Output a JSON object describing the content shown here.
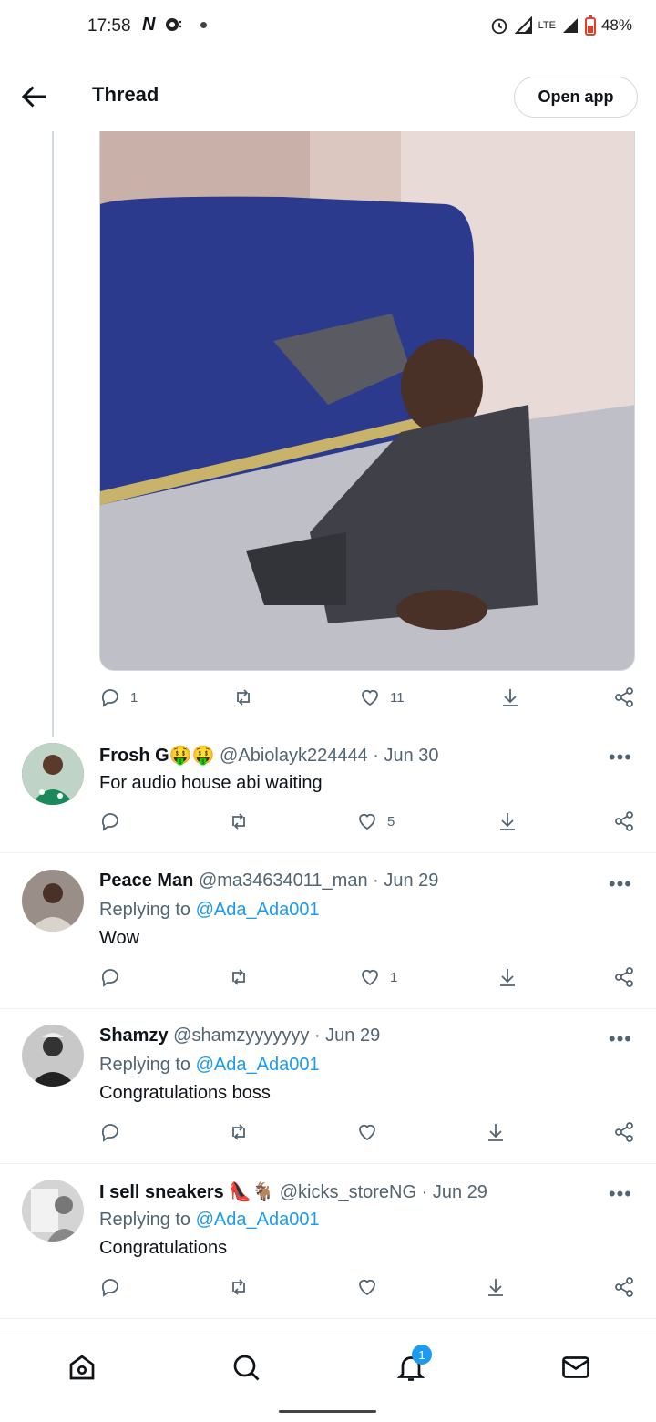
{
  "status_bar": {
    "time": "17:58",
    "network_label": "N",
    "lte_label": "LTE",
    "battery": "48%"
  },
  "header": {
    "title": "Thread",
    "open_app_label": "Open app"
  },
  "main_tweet": {
    "media_description_icon": "photo",
    "actions": {
      "replies": "1",
      "likes": "11"
    }
  },
  "replies": [
    {
      "name": "Frosh G🤑🤑",
      "handle": "@Abiolayk224444",
      "date": "· Jun 30",
      "replying_to": "",
      "text": "For audio house abi waiting",
      "likes": "5"
    },
    {
      "name": "Peace Man",
      "handle": "@ma34634011_man",
      "date": "· Jun 29",
      "replying_prefix": "Replying to ",
      "replying_to": "@Ada_Ada001",
      "text": "Wow",
      "likes": "1"
    },
    {
      "name": "Shamzy",
      "handle": "@shamzyyyyyyy",
      "date": "· Jun 29",
      "replying_prefix": "Replying to ",
      "replying_to": "@Ada_Ada001",
      "text": "Congratulations boss",
      "likes": ""
    },
    {
      "name": "I sell sneakers 👠🐐",
      "handle": "@kicks_storeNG",
      "date": "· Jun 29",
      "replying_prefix": "Replying to ",
      "replying_to": "@Ada_Ada001",
      "text": "Congratulations",
      "likes": ""
    }
  ],
  "more_label": "•••",
  "bottom_nav": {
    "notifications_badge": "1"
  },
  "colors": {
    "accent": "#1d9bf0",
    "muted": "#536471"
  }
}
